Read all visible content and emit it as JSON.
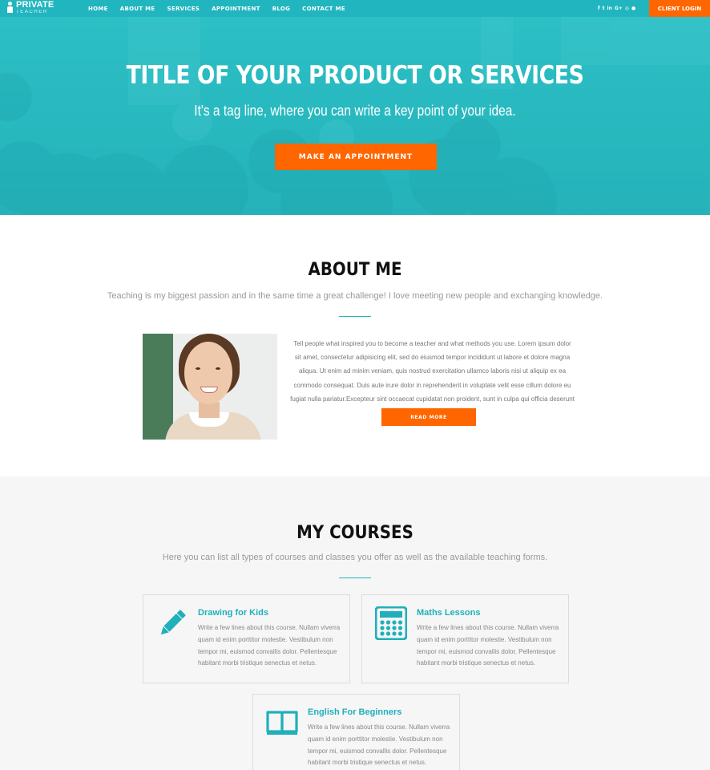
{
  "nav": {
    "logo_main": "PRIVATE",
    "logo_sub": "TEACHER",
    "items": [
      {
        "label": "HOME"
      },
      {
        "label": "ABOUT ME"
      },
      {
        "label": "SERVICES"
      },
      {
        "label": "APPOINTMENT"
      },
      {
        "label": "BLOG"
      },
      {
        "label": "CONTACT ME"
      }
    ],
    "socials": [
      {
        "icon": "facebook-icon",
        "glyph": "f"
      },
      {
        "icon": "twitter-icon",
        "glyph": "t"
      },
      {
        "icon": "linkedin-icon",
        "glyph": "in"
      },
      {
        "icon": "google-plus-icon",
        "glyph": "G+"
      },
      {
        "icon": "instagram-icon",
        "glyph": "◎"
      },
      {
        "icon": "skype-icon",
        "glyph": "●"
      }
    ],
    "client_login": "CLIENT LOGIN"
  },
  "hero": {
    "title": "TITLE OF YOUR PRODUCT OR SERVICES",
    "tagline": "It's a tag line, where you can write a key point of your idea.",
    "button": "MAKE AN APPOINTMENT"
  },
  "about": {
    "title": "ABOUT ME",
    "subtitle": "Teaching is my biggest passion and in the same time a great challenge! I love meeting new people and exchanging knowledge.",
    "body": "Tell people what inspired you to become a teacher and what methods you use. Lorem ipsum dolor sit amet, consectetur adipisicing elit, sed do eiusmod tempor incididunt ut labore et dolore magna aliqua. Ut enim ad minim veniam, quis nostrud exercitation ullamco laboris nisi ut aliquip ex ea commodo consequat. Duis aute irure dolor in reprehenderit in voluptate velit esse cillum dolore eu fugiat nulla pariatur.Excepteur sint occaecat cupidatat non proident, sunt in culpa qui officia deserunt mollit anim id est laborum.",
    "button": "READ MORE"
  },
  "courses": {
    "title": "MY COURSES",
    "subtitle": "Here you can list all types of courses and classes you offer as well as the available teaching forms.",
    "items": [
      {
        "title": "Drawing for Kids",
        "icon": "pencil-icon",
        "text": "Write a few lines about this course. Nullam viverra quam id enim porttitor molestie. Vestibulum non tempor mi, euismod convallis dolor. Pellentesque habitant morbi tristique senectus et netus."
      },
      {
        "title": "Maths Lessons",
        "icon": "calculator-icon",
        "text": "Write a few lines about this course. Nullam viverra quam id enim porttitor molestie. Vestibulum non tempor mi, euismod convallis dolor. Pellentesque habitant morbi tristique senectus et netus."
      },
      {
        "title": "English For Beginners",
        "icon": "book-icon",
        "text": "Write a few lines about this course. Nullam viverra quam id enim porttitor molestie. Vestibulum non tempor mi, euismod convallis dolor. Pellentesque habitant morbi tristique senectus et netus."
      }
    ]
  },
  "colors": {
    "brand_teal": "#21b5bf",
    "accent_orange": "#ff6600"
  }
}
